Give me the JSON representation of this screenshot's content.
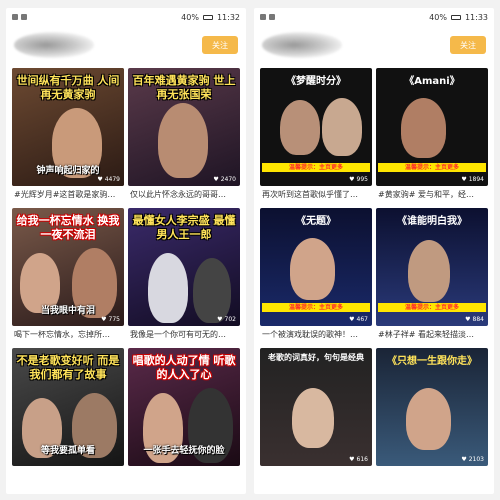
{
  "left_screen": {
    "status": {
      "battery": "40%",
      "time": "11:32"
    },
    "follow_label": "关注",
    "cards": [
      {
        "banner": "世间纵有千万曲 人间再无黄家驹",
        "subtitle": "钟声响起归家的",
        "likes": "4479",
        "desc": "#光辉岁月#这首歌是家驹…",
        "bg": "#5a3b2a"
      },
      {
        "banner": "百年难遇黄家驹 世上再无张国荣",
        "subtitle": "",
        "likes": "2470",
        "desc": "仅以此片怀念永远的哥哥…",
        "bg": "#3b2b3a"
      },
      {
        "banner": "给我一杯忘情水 换我一夜不流泪",
        "subtitle": "当我眼中有泪",
        "likes": "775",
        "desc": "喝下一杯忘情水，忘掉所…",
        "bg": "#4a3a3a"
      },
      {
        "banner": "最懂女人李宗盛 最懂男人王一郎",
        "subtitle": "",
        "likes": "702",
        "desc": "我像是一个你可有可无的…",
        "bg": "#2a2040"
      },
      {
        "banner": "不是老歌变好听 而是我们都有了故事",
        "subtitle": "等我要孤单看",
        "likes": "",
        "desc": "",
        "bg": "#2a2a2a"
      },
      {
        "banner": "唱歌的人动了情 听歌的人入了心",
        "subtitle": "一张手去轻抚你的脸",
        "likes": "",
        "desc": "",
        "bg": "#3a1a30"
      }
    ]
  },
  "right_screen": {
    "status": {
      "battery": "40%",
      "time": "11:33"
    },
    "follow_label": "关注",
    "cards": [
      {
        "title": "《梦醒时分》",
        "caption": "温馨提示：主页更多",
        "likes": "995",
        "desc": "再次听到这首歌似乎懂了…",
        "bg": "#1a1a1a"
      },
      {
        "title": "《Amani》",
        "caption": "温馨提示：主页更多",
        "likes": "1894",
        "desc": "#黄家驹# 爱与和平，经…",
        "bg": "#1a1a1a"
      },
      {
        "title": "《无题》",
        "caption": "温馨提示：主页更多",
        "likes": "467",
        "desc": "一个被演戏耽误的歌神！…",
        "bg": "#10142a"
      },
      {
        "title": "《谁能明白我》",
        "caption": "温馨提示：主页更多",
        "likes": "884",
        "desc": "#林子祥# 看起来轻描淡…",
        "bg": "#10142a"
      },
      {
        "title": "老歌的词真好，句句是经典",
        "caption": "",
        "likes": "616",
        "desc": "",
        "bg": "#2a2a2a"
      },
      {
        "title": "《只想一生跟你走》",
        "caption": "",
        "likes": "2103",
        "desc": "",
        "bg": "#1e2a3a"
      }
    ]
  },
  "colors": {
    "accent": "#f5b94a",
    "banner_red": "#c00000",
    "caption_yellow": "#ffe600"
  }
}
